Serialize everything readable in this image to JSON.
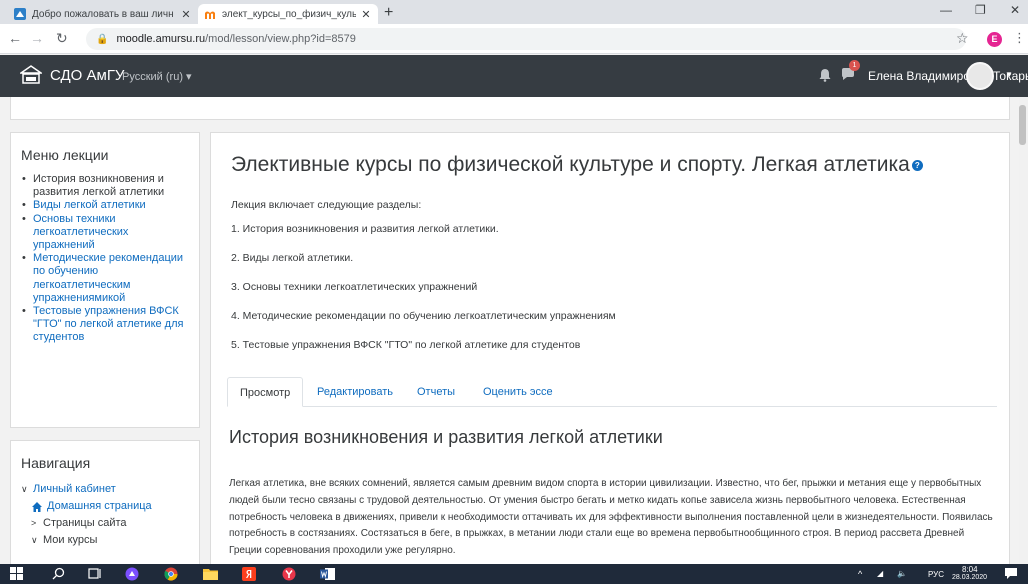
{
  "browser": {
    "tabs": [
      {
        "title": "Добро пожаловать в ваш личн",
        "active": false
      },
      {
        "title": "элект_курсы_по_физич_культ_и",
        "active": true
      }
    ],
    "new_tab_label": "+",
    "url_host": "moodle.amursu.ru",
    "url_path": "/mod/lesson/view.php?id=8579",
    "profile_initial": "E"
  },
  "navbar": {
    "brand": "СДО АмГУ",
    "language": "Русский (ru) ▾",
    "notification_count": "1",
    "user_name": "Елена Владимировна Токарь"
  },
  "menu_block": {
    "title": "Меню лекции",
    "items": [
      "История возникновения и развития легкой атлетики",
      "Виды легкой атлетики",
      "Основы техники легкоатлетических упражнений",
      "Методические рекомендации по обучению легкоатлетическим упражнениямикой",
      "Тестовые упражнения ВФСК \"ГТО\" по легкой атлетике для студентов"
    ]
  },
  "nav_block": {
    "title": "Навигация",
    "dashboard": "Личный кабинет",
    "home": "Домашняя страница",
    "site_pages": "Страницы сайта",
    "my_courses": "Мои курсы"
  },
  "main": {
    "title": "Элективные курсы по физической культуре и спорту. Легкая атлетика",
    "intro": "Лекция включает следующие разделы:",
    "sections": [
      "1. История возникновения и развития легкой атлетики.",
      "2. Виды легкой атлетики.",
      "3. Основы техники легкоатлетических упражнений",
      "4. Методические рекомендации по обучению легкоатлетическим упражнениям",
      "5. Тестовые упражнения ВФСК \"ГТО\" по легкой атлетике для студентов"
    ],
    "tabs": [
      "Просмотр",
      "Редактировать",
      "Отчеты",
      "Оценить эссе"
    ],
    "section_title": "История возникновения и развития легкой атлетики",
    "body": "Легкая атлетика, вне всяких сомнений, является самым древним видом спорта в истории цивилизации. Известно, что бег, прыжки и метания еще у первобытных людей были тесно связаны с трудовой деятельностью. От умения быстро бегать и метко кидать копье зависела жизнь первобытного человека. Естественная потребность человека в движениях, привели к необходимости оттачивать их для эффективности выполнения поставленной цели в жизнедеятельности. Появилась потребность в состязаниях. Состязаться в беге, в прыжках, в метании люди стали еще во времена первобытнообщинного строя. В период рассвета Древней Греции соревнования проходили уже регулярно."
  },
  "taskbar": {
    "lang": "РУС",
    "time": "8:04",
    "date": "28.03.2020"
  },
  "colors": {
    "navbar_bg": "#363c42",
    "link": "#0f6cbf",
    "taskbar_bg": "#1f2a3a",
    "badge": "#d9534f"
  }
}
